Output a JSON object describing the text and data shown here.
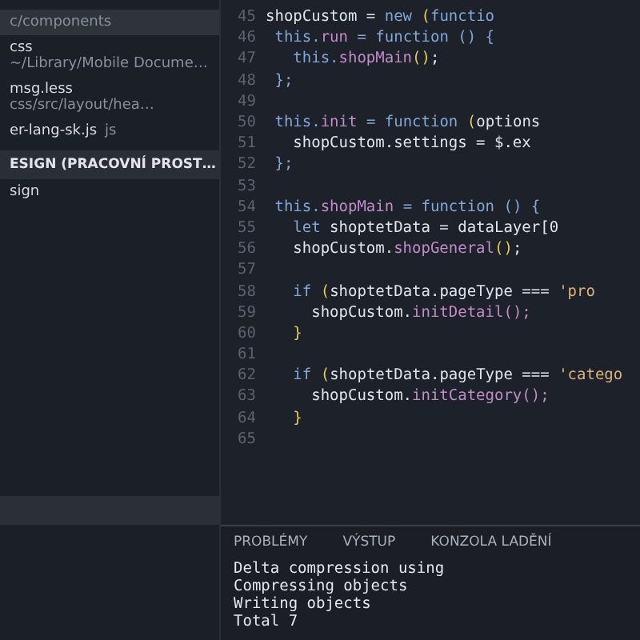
{
  "sidebar": {
    "open_editors": [
      {
        "path": "c/components",
        "selected": true
      },
      {
        "name": "css",
        "path": "~/Library/Mobile Docume…",
        "selected": false
      },
      {
        "name": "msg.less",
        "path": "css/src/layout/hea…",
        "selected": false
      },
      {
        "name": "er-lang-sk.js",
        "path": "js",
        "selected": false
      }
    ],
    "workspace": {
      "title": "ESIGN (PRACOVNÍ PROST…",
      "items": [
        {
          "name": "sign"
        }
      ]
    }
  },
  "editor": {
    "lines": [
      {
        "number": "45",
        "tokens": [
          {
            "t": "shopCustom = ",
            "kind": "plain"
          },
          {
            "t": "new ",
            "kind": "kw"
          },
          {
            "t": "(",
            "kind": "paren"
          },
          {
            "t": "functio",
            "kind": "kw"
          }
        ]
      },
      {
        "number": "46",
        "tokens": [
          {
            "t": " this.",
            "kind": "kw"
          },
          {
            "t": "run",
            "kind": "prop"
          },
          {
            "t": " = function () {",
            "kind": "kw"
          }
        ]
      },
      {
        "number": "47",
        "tokens": [
          {
            "t": "   this.",
            "kind": "kw"
          },
          {
            "t": "shopMain",
            "kind": "prop"
          },
          {
            "t": "()",
            "kind": "paren"
          },
          {
            "t": ";",
            "kind": "plain"
          }
        ]
      },
      {
        "number": "48",
        "tokens": [
          {
            "t": " };",
            "kind": "kw"
          }
        ]
      },
      {
        "number": "49"
      },
      {
        "number": "50",
        "tokens": [
          {
            "t": " this.",
            "kind": "kw"
          },
          {
            "t": "init",
            "kind": "prop"
          },
          {
            "t": " = function ",
            "kind": "kw"
          },
          {
            "t": "(",
            "kind": "paren"
          },
          {
            "t": "options",
            "kind": "plain"
          }
        ]
      },
      {
        "number": "51",
        "tokens": [
          {
            "t": "   shopCustom.settings = $.ex",
            "kind": "plain"
          }
        ]
      },
      {
        "number": "52",
        "tokens": [
          {
            "t": " };",
            "kind": "kw"
          }
        ]
      },
      {
        "number": "53"
      },
      {
        "number": "54",
        "tokens": [
          {
            "t": " this.",
            "kind": "kw"
          },
          {
            "t": "shopMain",
            "kind": "prop"
          },
          {
            "t": " = function () {",
            "kind": "kw"
          }
        ]
      },
      {
        "number": "55",
        "tokens": [
          {
            "t": "   let ",
            "kind": "kw"
          },
          {
            "t": "shoptetData = dataLayer[0",
            "kind": "plain"
          }
        ]
      },
      {
        "number": "56",
        "tokens": [
          {
            "t": "   shopCustom.",
            "kind": "plain"
          },
          {
            "t": "shopGeneral",
            "kind": "prop"
          },
          {
            "t": "()",
            "kind": "paren"
          },
          {
            "t": ";",
            "kind": "plain"
          }
        ]
      },
      {
        "number": "57"
      },
      {
        "number": "58",
        "tokens": [
          {
            "t": "   if ",
            "kind": "kw"
          },
          {
            "t": "(",
            "kind": "paren"
          },
          {
            "t": "shoptetData.pageType === ",
            "kind": "plain"
          },
          {
            "t": "'pro",
            "kind": "str"
          }
        ]
      },
      {
        "number": "59",
        "tokens": [
          {
            "t": "     shopCustom.",
            "kind": "plain"
          },
          {
            "t": "initDetail",
            "kind": "prop"
          },
          {
            "t": "();",
            "kind": "prop"
          }
        ]
      },
      {
        "number": "60",
        "tokens": [
          {
            "t": "   }",
            "kind": "paren"
          }
        ]
      },
      {
        "number": "61"
      },
      {
        "number": "62",
        "tokens": [
          {
            "t": "   if ",
            "kind": "kw"
          },
          {
            "t": "(",
            "kind": "paren"
          },
          {
            "t": "shoptetData.pageType === ",
            "kind": "plain"
          },
          {
            "t": "'catego",
            "kind": "str"
          }
        ]
      },
      {
        "number": "63",
        "tokens": [
          {
            "t": "     shopCustom.",
            "kind": "plain"
          },
          {
            "t": "initCategory",
            "kind": "prop"
          },
          {
            "t": "();",
            "kind": "prop"
          }
        ]
      },
      {
        "number": "64",
        "tokens": [
          {
            "t": "   }",
            "kind": "paren"
          }
        ]
      },
      {
        "number": "65"
      }
    ]
  },
  "panel": {
    "tabs": [
      "PROBLÉMY",
      "VÝSTUP",
      "KONZOLA LADĚNÍ"
    ],
    "terminal": [
      "Delta compression using",
      "Compressing objects",
      "Writing objects",
      "Total 7"
    ]
  }
}
